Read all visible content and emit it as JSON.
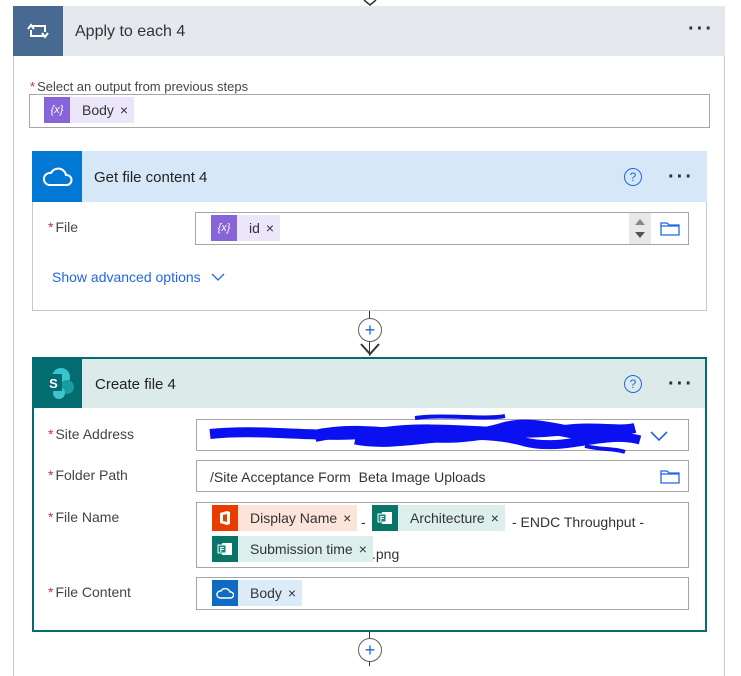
{
  "apply_each": {
    "title": "Apply to each 4"
  },
  "select_output": {
    "required": "*",
    "label": "Select an output from previous steps",
    "token": {
      "icon_text": "{x}",
      "label": "Body",
      "remove": "×"
    }
  },
  "get_file": {
    "title": "Get file content 4",
    "help": "?",
    "file_label": "File",
    "file_token": {
      "icon_text": "{x}",
      "label": "id",
      "remove": "×"
    },
    "show_advanced": "Show advanced options"
  },
  "create_file": {
    "title": "Create file 4",
    "help": "?",
    "site_address_label": "Site Address",
    "folder_path_label": "Folder Path",
    "folder_path_value": "/Site Acceptance Form  Beta Image Uploads",
    "file_name_label": "File Name",
    "file_name_tokens": [
      {
        "label": "Display Name",
        "remove": "×"
      },
      {
        "label": "Architecture",
        "remove": "×"
      },
      {
        "label": "Submission time",
        "remove": "×"
      }
    ],
    "file_name_text": [
      "-",
      "- ENDC Throughput -",
      ".png"
    ],
    "file_content_label": "File Content",
    "file_content_token": {
      "label": "Body",
      "remove": "×"
    }
  },
  "colors": {
    "header_gray": "#e5e8ed",
    "loop_icon_bg": "#486991",
    "onedrive_bg": "#0078d4",
    "sharepoint_bg": "#036c70",
    "dynamic_purple": "#8764d8",
    "office_orange": "#eb3c00",
    "forms_green": "#077568"
  },
  "icons": [
    "loop-icon",
    "onedrive-cloud-icon",
    "sharepoint-icon",
    "office-icon",
    "forms-icon",
    "folder-icon",
    "chevron-down-icon",
    "help-icon",
    "add-step-icon"
  ]
}
